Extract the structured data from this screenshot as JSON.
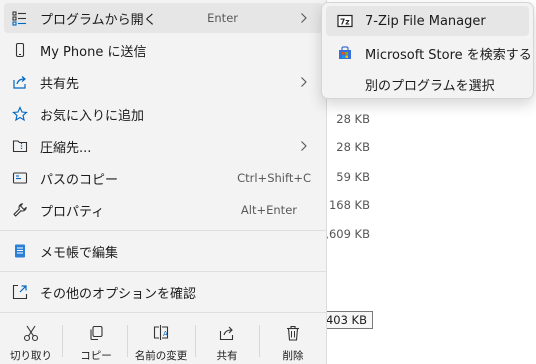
{
  "file_sizes": [
    {
      "text": "28 KB"
    },
    {
      "text": "28 KB"
    },
    {
      "text": "59 KB"
    },
    {
      "text": "168 KB"
    },
    {
      "text": ",609 KB"
    }
  ],
  "selected_size": "403 KB",
  "menu": {
    "items": [
      {
        "label": "プログラムから開く",
        "accelerator": "Enter"
      },
      {
        "label": "My Phone に送信"
      },
      {
        "label": "共有先"
      },
      {
        "label": "お気に入りに追加"
      },
      {
        "label": "圧縮先..."
      },
      {
        "label": "パスのコピー",
        "accelerator": "Ctrl+Shift+C"
      },
      {
        "label": "プロパティ",
        "accelerator": "Alt+Enter"
      },
      {
        "label": "メモ帳で編集"
      },
      {
        "label": "その他のオプションを確認"
      }
    ],
    "actions": [
      {
        "label": "切り取り"
      },
      {
        "label": "コピー"
      },
      {
        "label": "名前の変更"
      },
      {
        "label": "共有"
      },
      {
        "label": "削除"
      }
    ]
  },
  "submenu": {
    "items": [
      {
        "label": "7-Zip File Manager",
        "icon_text": "7z"
      },
      {
        "label": "Microsoft Store を検索する"
      },
      {
        "label": "別のプログラムを選択"
      }
    ]
  },
  "colors": {
    "menu_bg": "#f3f3f3",
    "hover_bg": "#e6e6e6",
    "accent_blue": "#0067c0",
    "notepad_blue": "#2b7fd6"
  }
}
